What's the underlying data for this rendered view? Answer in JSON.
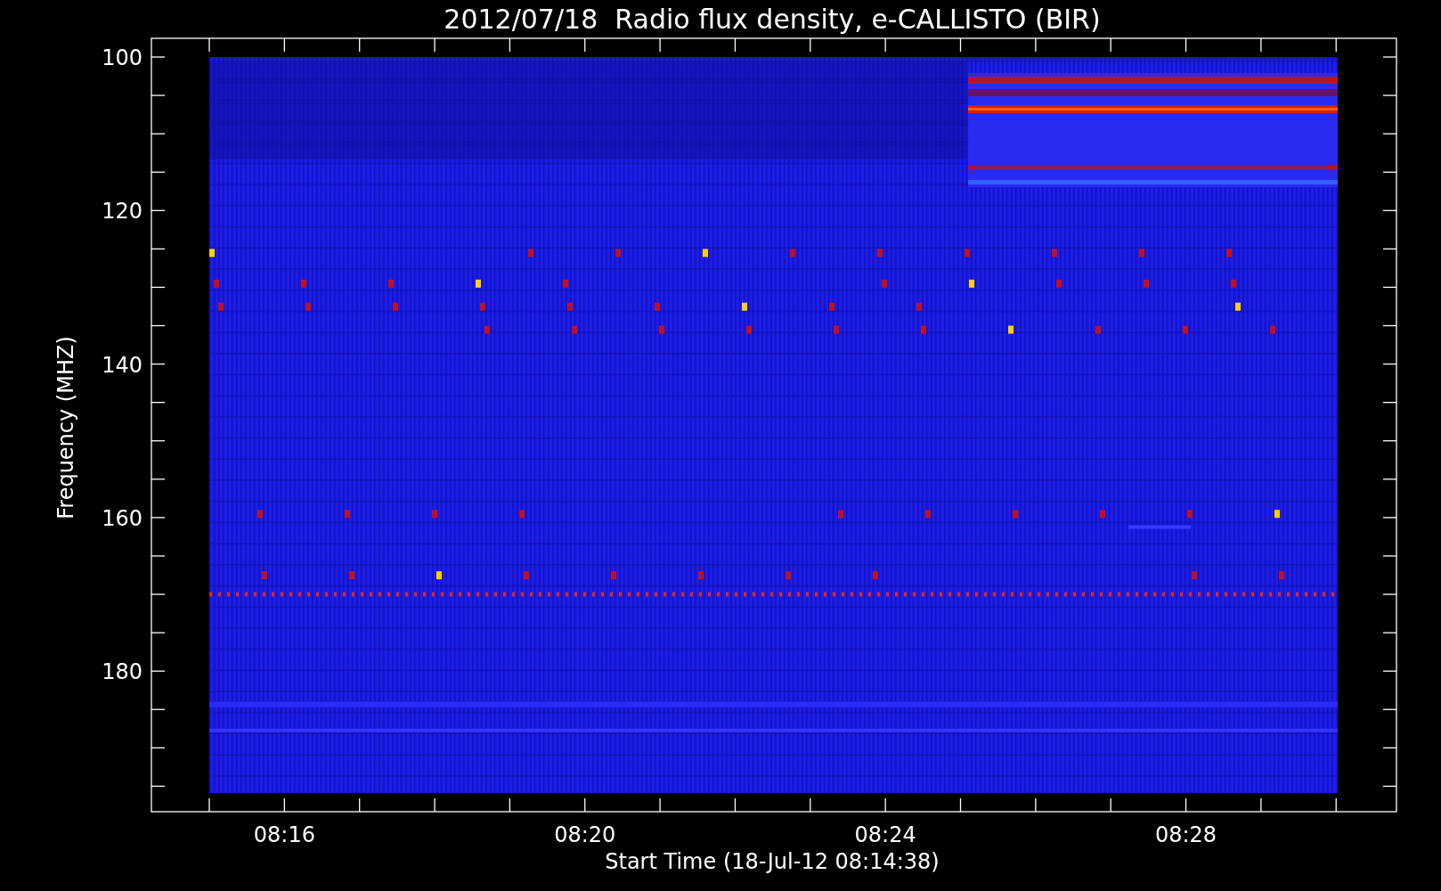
{
  "title": "2012/07/18  Radio flux density, e-CALLISTO (BIR)",
  "y_axis": {
    "label": "Frequency (MHZ)",
    "ticks": [
      "100",
      "120",
      "140",
      "160",
      "180"
    ]
  },
  "x_axis": {
    "label": "Start Time (18-Jul-12 08:14:38)",
    "ticks": [
      "08:16",
      "08:20",
      "08:24",
      "08:28"
    ]
  }
}
